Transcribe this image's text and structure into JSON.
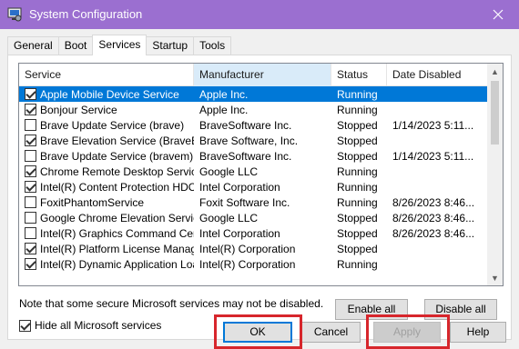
{
  "window": {
    "title": "System Configuration",
    "close_glyph": "✕"
  },
  "tabs": [
    {
      "label": "General"
    },
    {
      "label": "Boot"
    },
    {
      "label": "Services"
    },
    {
      "label": "Startup"
    },
    {
      "label": "Tools"
    }
  ],
  "active_tab": "Services",
  "table": {
    "headers": [
      "Service",
      "Manufacturer",
      "Status",
      "Date Disabled"
    ],
    "rows": [
      {
        "checked": true,
        "service": "Apple Mobile Device Service",
        "manufacturer": "Apple Inc.",
        "status": "Running",
        "date": ""
      },
      {
        "checked": true,
        "service": "Bonjour Service",
        "manufacturer": "Apple Inc.",
        "status": "Running",
        "date": ""
      },
      {
        "checked": false,
        "service": "Brave Update Service (brave)",
        "manufacturer": "BraveSoftware Inc.",
        "status": "Stopped",
        "date": "1/14/2023 5:11..."
      },
      {
        "checked": true,
        "service": "Brave Elevation Service (BraveEl...",
        "manufacturer": "Brave Software, Inc.",
        "status": "Stopped",
        "date": ""
      },
      {
        "checked": false,
        "service": "Brave Update Service (bravem)",
        "manufacturer": "BraveSoftware Inc.",
        "status": "Stopped",
        "date": "1/14/2023 5:11..."
      },
      {
        "checked": true,
        "service": "Chrome Remote Desktop Service",
        "manufacturer": "Google LLC",
        "status": "Running",
        "date": ""
      },
      {
        "checked": true,
        "service": "Intel(R) Content Protection HDC...",
        "manufacturer": "Intel Corporation",
        "status": "Running",
        "date": ""
      },
      {
        "checked": false,
        "service": "FoxitPhantomService",
        "manufacturer": "Foxit Software Inc.",
        "status": "Running",
        "date": "8/26/2023 8:46..."
      },
      {
        "checked": false,
        "service": "Google Chrome Elevation Servic...",
        "manufacturer": "Google LLC",
        "status": "Stopped",
        "date": "8/26/2023 8:46..."
      },
      {
        "checked": false,
        "service": "Intel(R) Graphics Command Cen...",
        "manufacturer": "Intel Corporation",
        "status": "Stopped",
        "date": "8/26/2023 8:46..."
      },
      {
        "checked": true,
        "service": "Intel(R) Platform License Manag...",
        "manufacturer": "Intel(R) Corporation",
        "status": "Stopped",
        "date": ""
      },
      {
        "checked": true,
        "service": "Intel(R) Dynamic Application Loa...",
        "manufacturer": "Intel(R) Corporation",
        "status": "Running",
        "date": ""
      }
    ],
    "selected_index": 0
  },
  "note": "Note that some secure Microsoft services may not be disabled.",
  "enable_all": "Enable all",
  "disable_all": "Disable all",
  "hide_ms": {
    "label": "Hide all Microsoft services",
    "checked": true
  },
  "buttons": {
    "ok": "OK",
    "cancel": "Cancel",
    "apply": "Apply",
    "help": "Help"
  },
  "colors": {
    "titlebar": "#9b6fd0",
    "selection": "#0078d7",
    "highlight": "#d7262c"
  }
}
